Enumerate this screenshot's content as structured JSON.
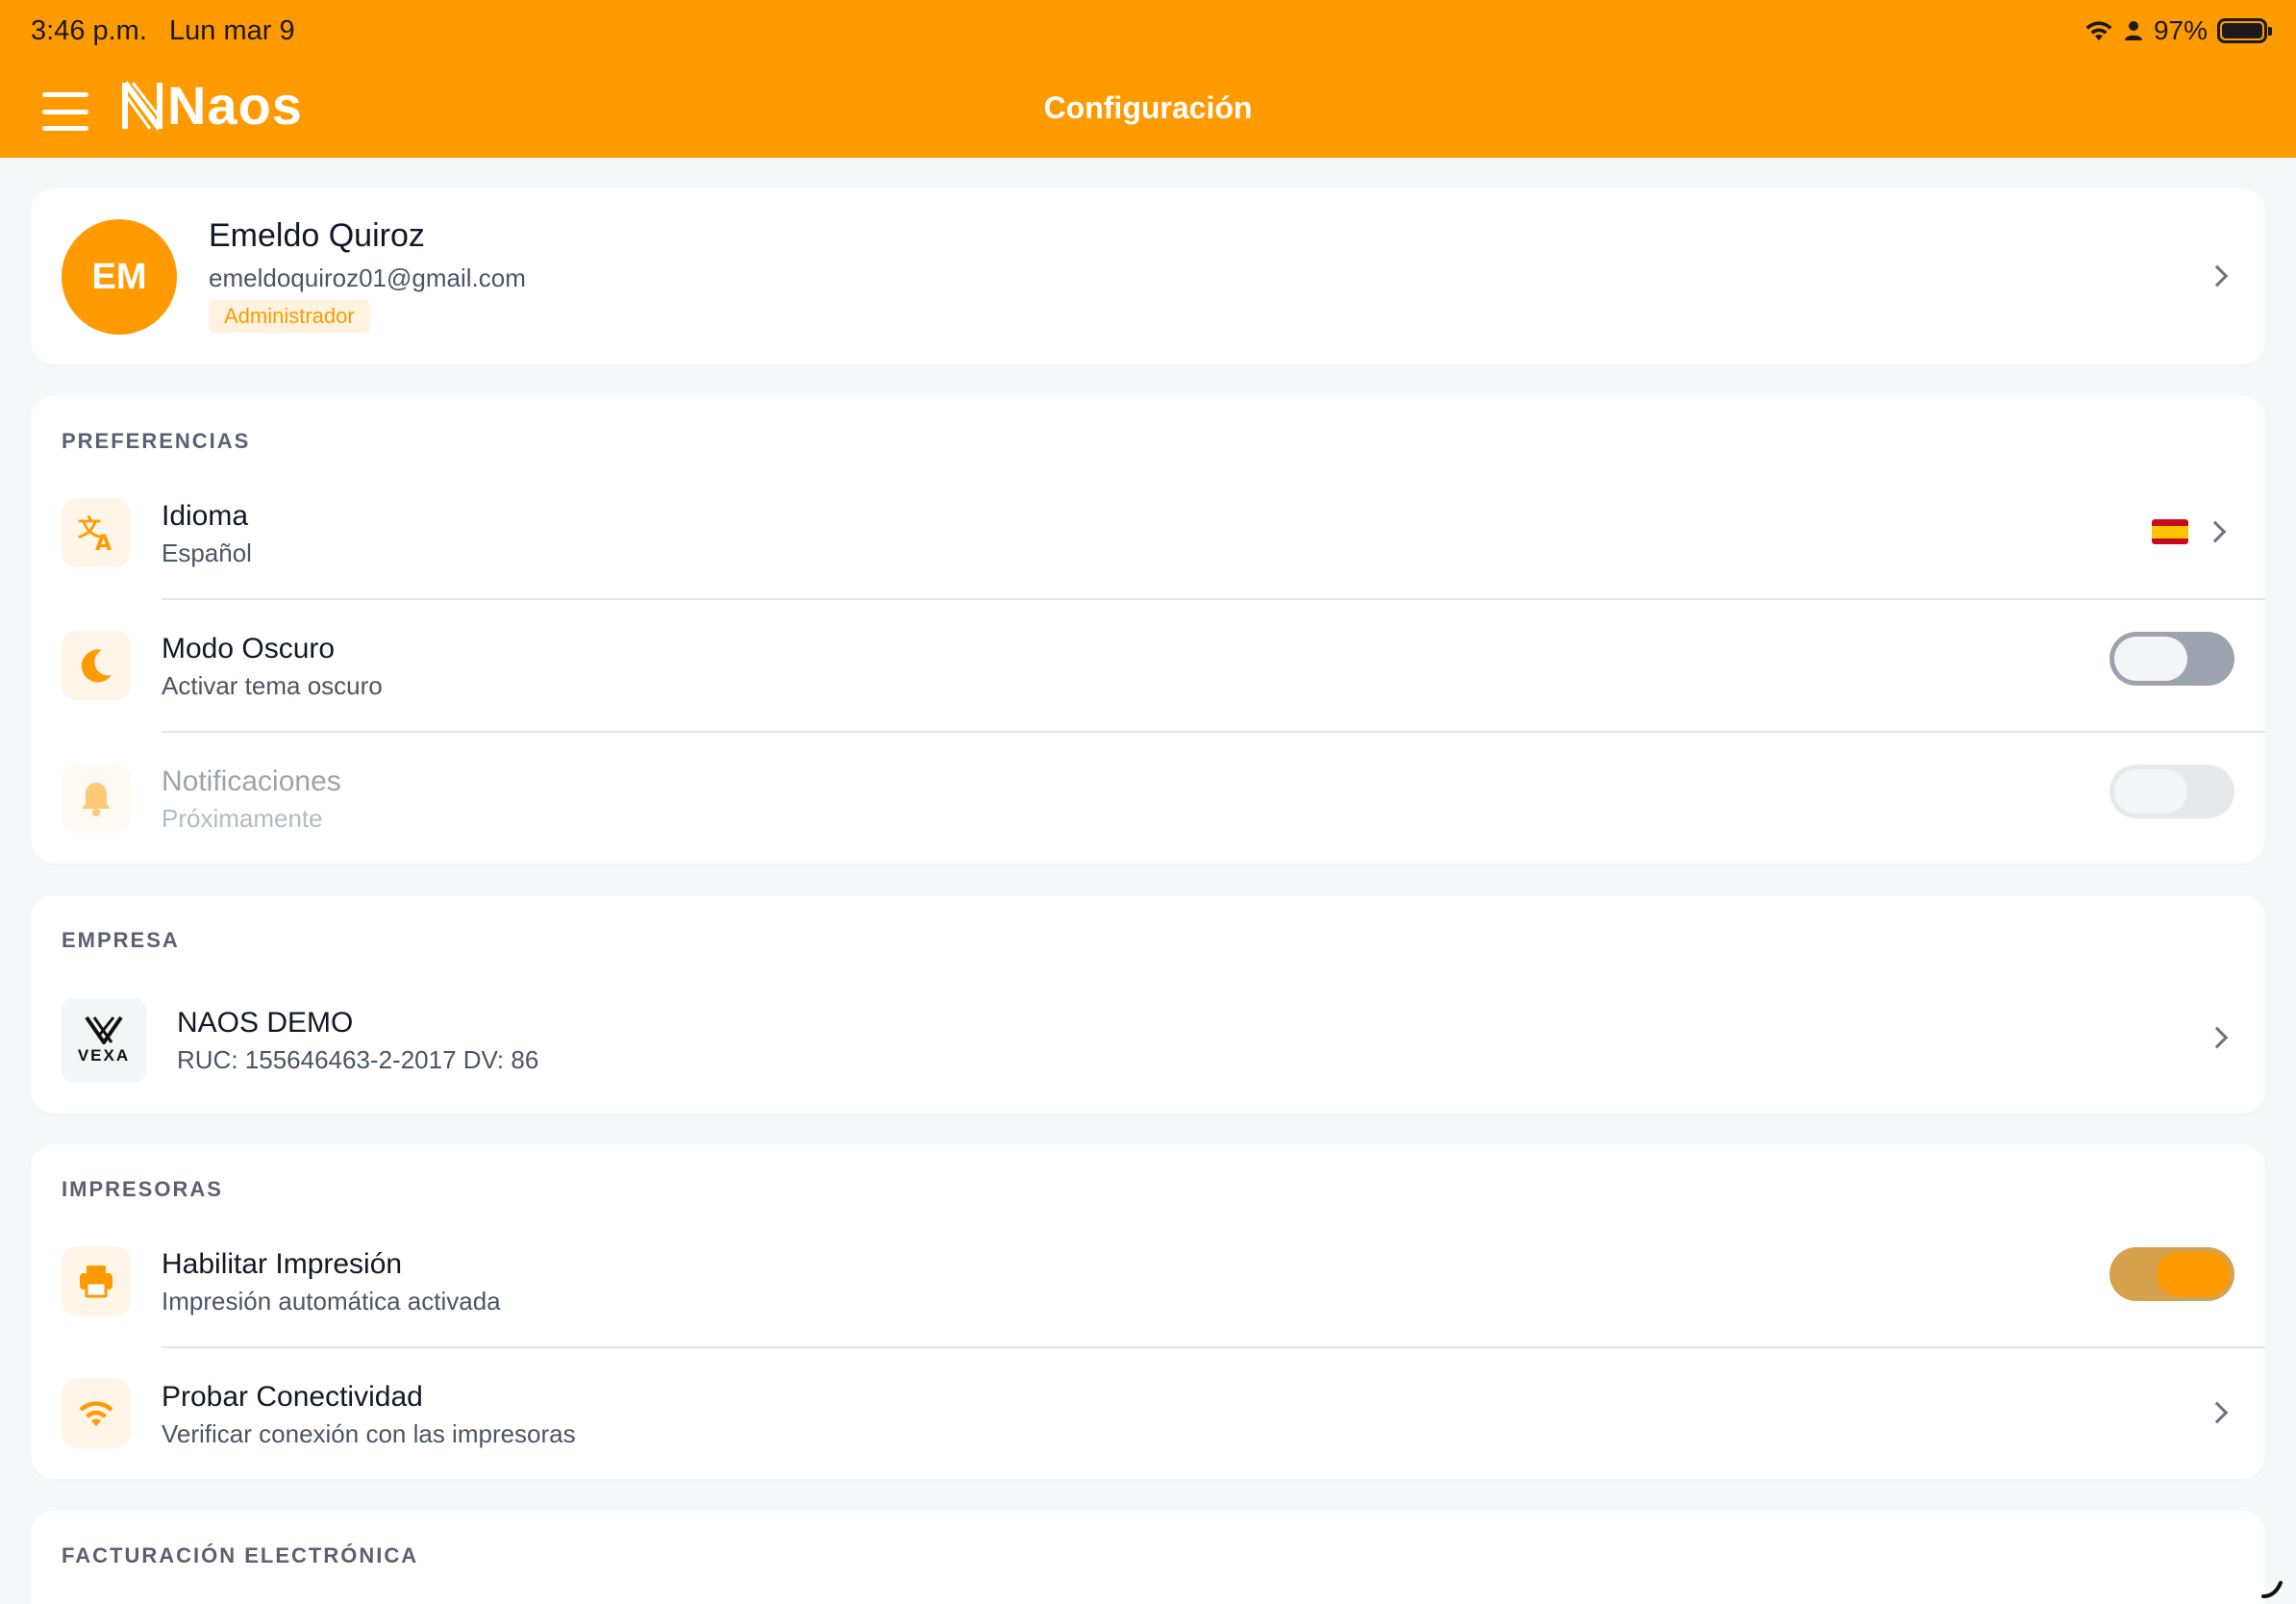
{
  "status_bar": {
    "time": "3:46 p.m.",
    "date": "Lun mar 9",
    "battery": "97%"
  },
  "header": {
    "logo_text": "Naos",
    "title": "Configuración"
  },
  "profile": {
    "initials": "EM",
    "name": "Emeldo Quiroz",
    "email": "emeldoquiroz01@gmail.com",
    "role": "Administrador"
  },
  "preferences": {
    "section_title": "PREFERENCIAS",
    "language": {
      "title": "Idioma",
      "value": "Español"
    },
    "dark_mode": {
      "title": "Modo Oscuro",
      "subtitle": "Activar tema oscuro",
      "enabled": false
    },
    "notifications": {
      "title": "Notificaciones",
      "subtitle": "Próximamente",
      "enabled": false,
      "disabled": true
    }
  },
  "company": {
    "section_title": "EMPRESA",
    "logo_label": "VEXA",
    "name": "NAOS DEMO",
    "ruc": "RUC: 155646463-2-2017 DV: 86"
  },
  "printers": {
    "section_title": "IMPRESORAS",
    "enable_print": {
      "title": "Habilitar Impresión",
      "subtitle": "Impresión automática activada",
      "enabled": true
    },
    "test_connectivity": {
      "title": "Probar Conectividad",
      "subtitle": "Verificar conexión con las impresoras"
    }
  },
  "invoicing": {
    "section_title": "FACTURACIÓN ELECTRÓNICA"
  },
  "colors": {
    "brand": "#ff9a00",
    "background": "#f7f8fa"
  }
}
